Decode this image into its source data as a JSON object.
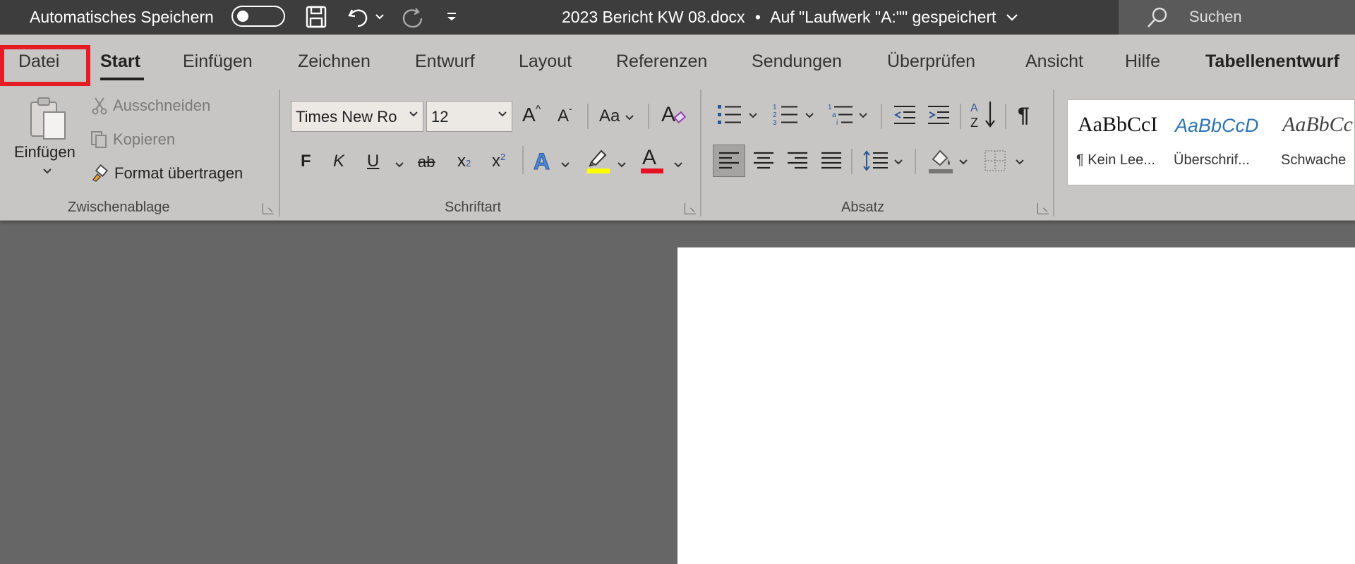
{
  "titlebar": {
    "autosave_label": "Automatisches Speichern",
    "document_title": "2023 Bericht KW 08.docx",
    "separator": "•",
    "save_status": "Auf \"Laufwerk \"A:\"\" gespeichert",
    "search_label": "Suchen"
  },
  "tabs": [
    "Datei",
    "Start",
    "Einfügen",
    "Zeichnen",
    "Entwurf",
    "Layout",
    "Referenzen",
    "Sendungen",
    "Überprüfen",
    "Ansicht",
    "Hilfe",
    "Tabellenentwurf"
  ],
  "active_tab": "Start",
  "highlight_color": "#e51c23",
  "clipboard": {
    "paste_label": "Einfügen",
    "cut_label": "Ausschneiden",
    "copy_label": "Kopieren",
    "format_painter_label": "Format übertragen",
    "group_label": "Zwischenablage"
  },
  "font": {
    "font_name": "Times New Ro",
    "font_size": "12",
    "grow_label": "A",
    "shrink_label": "A",
    "case_label": "Aa",
    "bold_label": "F",
    "italic_label": "K",
    "underline_label": "U",
    "strike_label": "ab",
    "subscript_label": "x",
    "superscript_label": "x",
    "subscript_mark": "2",
    "superscript_mark": "2",
    "effects_label": "A",
    "font_color_label": "A",
    "highlight_swatch": "#ffff00",
    "font_color_swatch": "#e81123",
    "group_label": "Schriftart"
  },
  "paragraph": {
    "pilcrow": "¶",
    "sort_top": "A",
    "sort_bottom": "Z",
    "group_label": "Absatz"
  },
  "styles": [
    {
      "sample": "AaBbCcI",
      "name": "¶ Kein Lee..."
    },
    {
      "sample": "AaBbCcD",
      "name": "Überschrif..."
    },
    {
      "sample": "AaBbCc",
      "name": "Schwache"
    }
  ]
}
